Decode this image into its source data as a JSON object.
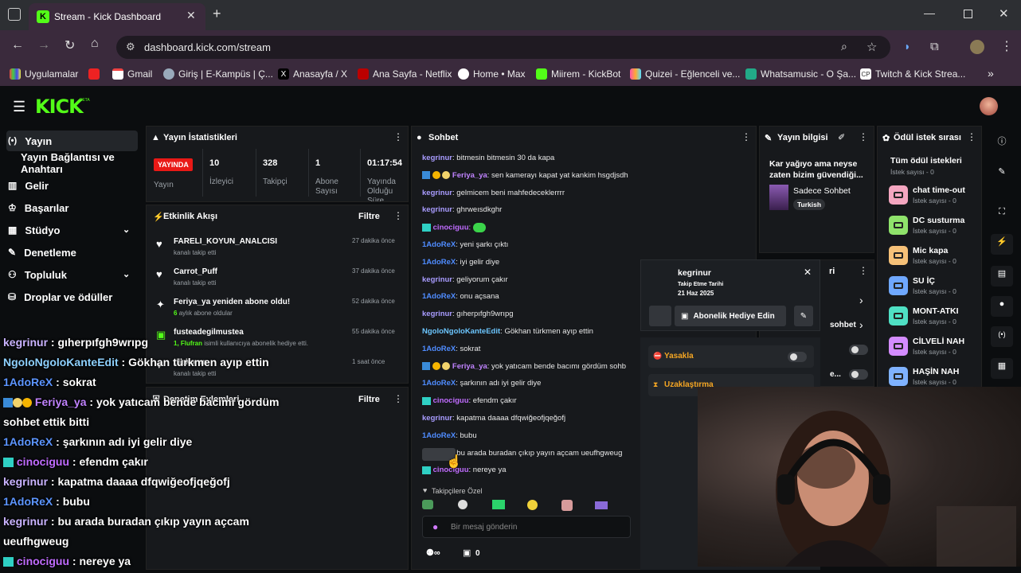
{
  "browser": {
    "tab_title": "Stream - Kick Dashboard",
    "url": "dashboard.kick.com/stream",
    "bookmarks": [
      "Uygulamalar",
      "Gmail",
      "Giriş | E-Kampüs | Ç...",
      "Anasayfa / X",
      "Ana Sayfa - Netflix",
      "Home • Max",
      "Miirem - KickBot",
      "Quizei - Eğlenceli ve...",
      "Whatsamusic - O Şa...",
      "Twitch & Kick Strea..."
    ]
  },
  "kick": {
    "logo": "KICK",
    "logo_tag": "BETA"
  },
  "sidebar": {
    "items": [
      {
        "label": "Yayın",
        "icon": "broadcast-icon"
      },
      {
        "label": "Yayın Bağlantısı ve Anahtarı",
        "icon": ""
      },
      {
        "label": "Gelir",
        "icon": "chart-icon"
      },
      {
        "label": "Başarılar",
        "icon": "trophy-icon"
      },
      {
        "label": "Stüdyo",
        "icon": "studio-icon"
      },
      {
        "label": "Denetleme",
        "icon": "wrench-icon"
      },
      {
        "label": "Topluluk",
        "icon": "people-icon"
      },
      {
        "label": "Droplar ve ödüller",
        "icon": "drops-icon"
      }
    ]
  },
  "stats": {
    "title": "Yayın İstatistikleri",
    "live_badge": "YAYINDA",
    "cols": [
      {
        "value": "",
        "label": "Yayın"
      },
      {
        "value": "10",
        "label": "İzleyici"
      },
      {
        "value": "328",
        "label": "Takipçi"
      },
      {
        "value": "1",
        "label": "Abone Sayısı"
      },
      {
        "value": "01:17:54",
        "label": "Yayında Olduğu Süre"
      }
    ]
  },
  "activity": {
    "title": "Etkinlik Akışı",
    "filter": "Filtre",
    "items": [
      {
        "title": "FARELI_KOYUN_ANALCISI",
        "sub": "kanalı takip etti",
        "time": "27 dakika önce"
      },
      {
        "title": "Carrot_Puff",
        "sub": "kanalı takip etti",
        "time": "37 dakika önce"
      },
      {
        "title": "Feriya_ya yeniden abone oldu!",
        "sub_num": "6",
        "sub": "aylık abone oldular",
        "time": "52 dakika önce"
      },
      {
        "title": "fusteadegilmustea",
        "sub_num": "1, Flufran",
        "sub": "isimli kullanıcıya abonelik hediye etti.",
        "time": "55 dakika önce"
      },
      {
        "title": "thekoran",
        "sub": "kanalı takip etti",
        "time": "1 saat önce"
      }
    ]
  },
  "moderation": {
    "title": "Denetim Eylemleri",
    "filter": "Filtre"
  },
  "chat": {
    "title": "Sohbet",
    "messages": [
      {
        "user": "kegrinur",
        "text": "bitmesin bitmesin 30 da kapa",
        "cls": "u-l"
      },
      {
        "user": "Feriya_ya",
        "text": "sen kamerayı kapat yat kankim hsgdjsdh",
        "cls": "u-p",
        "badges": true
      },
      {
        "user": "kegrinur",
        "text": "gelmicem beni mahfedeceklerrrr",
        "cls": "u-l"
      },
      {
        "user": "kegrinur",
        "text": "ghrweısdkghr",
        "cls": "u-l"
      },
      {
        "user": "cinociguu",
        "text": "",
        "cls": "u-c",
        "emote": true
      },
      {
        "user": "1AdoReX",
        "text": "yeni şarkı çıktı",
        "cls": "u-b"
      },
      {
        "user": "1AdoReX",
        "text": "iyi gelir diye",
        "cls": "u-b"
      },
      {
        "user": "kegrinur",
        "text": "geliyorum çakır",
        "cls": "u-l"
      },
      {
        "user": "1AdoReX",
        "text": "onu açsana",
        "cls": "u-b"
      },
      {
        "user": "kegrinur",
        "text": "gıherpıfgh9wrıpg",
        "cls": "u-l"
      },
      {
        "user": "NgoloNgoloKanteEdit",
        "text": "Gökhan türkmen ayıp ettin",
        "cls": "u-t"
      },
      {
        "user": "1AdoReX",
        "text": "sokrat",
        "cls": "u-b"
      },
      {
        "user": "Feriya_ya",
        "text": "yok yatıcam bende bacımı gördüm sohb",
        "cls": "u-p",
        "badges": true
      },
      {
        "user": "1AdoReX",
        "text": "şarkının adı iyi gelir diye",
        "cls": "u-b"
      },
      {
        "user": "cinociguu",
        "text": "efendm çakır",
        "cls": "u-c"
      },
      {
        "user": "kegrinur",
        "text": "kapatma daaaa dfqwiğeofjqeğofj",
        "cls": "u-l"
      },
      {
        "user": "1AdoReX",
        "text": "bubu",
        "cls": "u-b"
      },
      {
        "user": "kegrinur",
        "text": "bu arada buradan çıkıp yayın açcam ueufhgweug",
        "cls": "u-l"
      },
      {
        "user": "cinociguu",
        "text": "nereye ya",
        "cls": "u-c"
      }
    ],
    "followers_only": "Takipçilere Özel",
    "input_placeholder": "Bir mesaj gönderin",
    "footer_count": "0"
  },
  "stream_info": {
    "title": "Yayın bilgisi",
    "stream_title": "Kar yağıyo ama neyse zaten bizim güvendiği...",
    "category": "Sadece Sohbet",
    "tag": "Turkish"
  },
  "user_card": {
    "username": "kegrinur",
    "follow_label": "Takip Etme Tarihi",
    "follow_date": "21 Haz 2025",
    "gift_button": "Abonelik Hediye Edin",
    "ban_label": "Yasakla",
    "timeout_label": "Uzaklaştırma"
  },
  "partial_panel": {
    "frag1": "ri",
    "frag2": "sohbet",
    "frag3": "e..."
  },
  "rewards": {
    "title": "Ödül istek sırası",
    "all": "Tüm ödül istekleri",
    "all_count": "İstek sayısı - 0",
    "items": [
      {
        "label": "chat time-out",
        "count": "İstek sayısı - 0",
        "color": "#f4a6c0"
      },
      {
        "label": "DC susturma",
        "count": "İstek sayısı - 0",
        "color": "#8fe36b"
      },
      {
        "label": "Mic kapa",
        "count": "İstek sayısı - 0",
        "color": "#f6c178"
      },
      {
        "label": "SU İÇ",
        "count": "İstek sayısı - 0",
        "color": "#6fa8ff"
      },
      {
        "label": "MONT-ATKI",
        "count": "İstek sayısı - 0",
        "color": "#4fe0c4"
      },
      {
        "label": "CİLVELİ NAH",
        "count": "İstek sayısı - 0",
        "color": "#d48cff"
      },
      {
        "label": "HAŞİN NAH",
        "count": "İstek sayısı - 0",
        "color": "#7fb2ff"
      }
    ]
  },
  "overlay_chat": [
    {
      "user": "kegrinur",
      "text": "gıherpıfgh9wrıpg",
      "color": "#c9b3ff"
    },
    {
      "user": "NgoloNgoloKanteEdit",
      "text": "Gökhan türkmen ayıp ettin",
      "color": "#8ed1ff"
    },
    {
      "user": "1AdoReX",
      "text": "sokrat",
      "color": "#5c95ff"
    },
    {
      "user": "Feriya_ya",
      "text": "yok yatıcam bende bacımı gördüm",
      "color": "#c083ff",
      "badges": true
    },
    {
      "user": "",
      "text": "sohbet ettik bitti",
      "color": "#fff"
    },
    {
      "user": "1AdoReX",
      "text": "şarkının adı iyi gelir diye",
      "color": "#5c95ff"
    },
    {
      "user": "cinociguu",
      "text": "efendm çakır",
      "color": "#c06cff",
      "badge2": true
    },
    {
      "user": "kegrinur",
      "text": "kapatma daaaa dfqwiğeofjqeğofj",
      "color": "#c9b3ff"
    },
    {
      "user": "1AdoReX",
      "text": "bubu",
      "color": "#5c95ff"
    },
    {
      "user": "kegrinur",
      "text": "bu arada buradan çıkıp yayın açcam",
      "color": "#c9b3ff"
    },
    {
      "user": "",
      "text": "ueufhgweug",
      "color": "#fff"
    },
    {
      "user": "cinociguu",
      "text": "nereye ya",
      "color": "#c06cff",
      "badge2": true
    }
  ],
  "colors": {
    "kick_green": "#53fc18",
    "live_red": "#e91916",
    "panel": "#17191c"
  }
}
